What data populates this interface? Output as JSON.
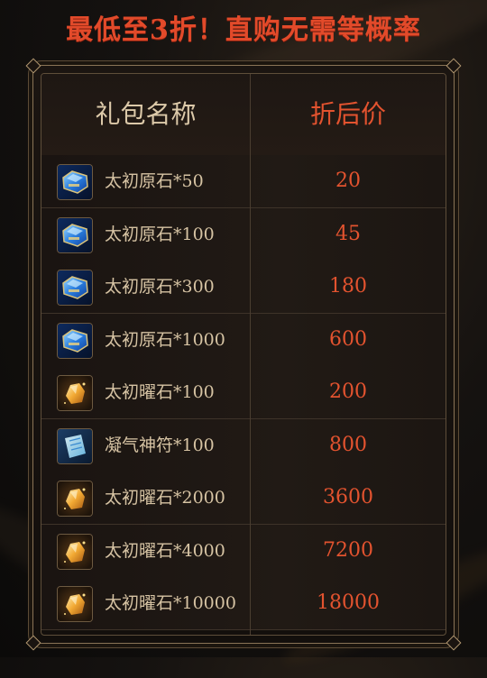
{
  "headline": "最低至3折！直购无需等概率",
  "table": {
    "header_name": "礼包名称",
    "header_price": "折后价",
    "rows": [
      {
        "icon": "blue-gem-icon",
        "name": "太初原石*50",
        "price": "20"
      },
      {
        "icon": "blue-gem-icon",
        "name": "太初原石*100",
        "price": "45"
      },
      {
        "icon": "blue-gem-icon",
        "name": "太初原石*300",
        "price": "180"
      },
      {
        "icon": "blue-gem-icon",
        "name": "太初原石*1000",
        "price": "600"
      },
      {
        "icon": "gold-ore-icon",
        "name": "太初曜石*100",
        "price": "200"
      },
      {
        "icon": "talisman-scroll-icon",
        "name": "凝气神符*100",
        "price": "800"
      },
      {
        "icon": "gold-ore-icon",
        "name": "太初曜石*2000",
        "price": "3600"
      },
      {
        "icon": "gold-ore-icon",
        "name": "太初曜石*4000",
        "price": "7200"
      },
      {
        "icon": "gold-ore-icon",
        "name": "太初曜石*10000",
        "price": "18000"
      }
    ]
  },
  "colors": {
    "accent_red": "#e24a2a",
    "label_gold": "#d6c3a3",
    "border_bronze": "#8a7456"
  }
}
